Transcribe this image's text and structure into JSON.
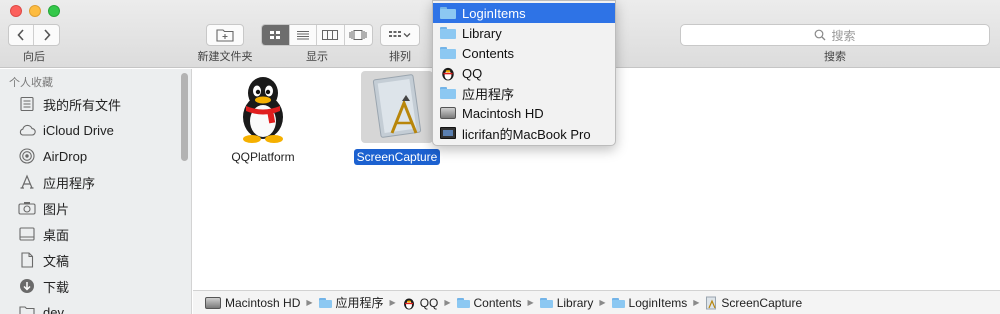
{
  "toolbar": {
    "back_label": "向后",
    "new_folder_label": "新建文件夹",
    "view_label": "显示",
    "arrange_label": "排列",
    "search_placeholder": "搜索",
    "search_label": "搜索",
    "view_mode_selected": "icon"
  },
  "sidebar": {
    "header": "个人收藏",
    "items": [
      {
        "label": "我的所有文件",
        "icon": "all-files-icon"
      },
      {
        "label": "iCloud Drive",
        "icon": "cloud-icon"
      },
      {
        "label": "AirDrop",
        "icon": "airdrop-icon"
      },
      {
        "label": "应用程序",
        "icon": "applications-icon"
      },
      {
        "label": "图片",
        "icon": "camera-icon"
      },
      {
        "label": "桌面",
        "icon": "desktop-icon"
      },
      {
        "label": "文稿",
        "icon": "document-icon"
      },
      {
        "label": "下载",
        "icon": "download-icon"
      },
      {
        "label": "dev",
        "icon": "folder-icon"
      }
    ]
  },
  "files": [
    {
      "name": "QQPlatform",
      "icon": "penguin-icon",
      "selected": false
    },
    {
      "name": "ScreenCapture",
      "icon": "app-icon",
      "selected": true
    }
  ],
  "path_menu": {
    "items": [
      {
        "label": "LoginItems",
        "icon": "folder-icon",
        "highlighted": true
      },
      {
        "label": "Library",
        "icon": "folder-icon",
        "highlighted": false
      },
      {
        "label": "Contents",
        "icon": "folder-icon",
        "highlighted": false
      },
      {
        "label": "QQ",
        "icon": "penguin-icon",
        "highlighted": false
      },
      {
        "label": "应用程序",
        "icon": "applications-folder-icon",
        "highlighted": false
      },
      {
        "label": "Macintosh HD",
        "icon": "hard-drive-icon",
        "highlighted": false
      },
      {
        "label": "licrifan的MacBook Pro",
        "icon": "laptop-icon",
        "highlighted": false
      }
    ]
  },
  "path_bar": {
    "segments": [
      "Macintosh HD",
      "应用程序",
      "QQ",
      "Contents",
      "Library",
      "LoginItems",
      "ScreenCapture"
    ]
  },
  "colors": {
    "selection": "#1c61d0",
    "menu_highlight": "#2e73e6",
    "folder": "#8cc8f2"
  }
}
